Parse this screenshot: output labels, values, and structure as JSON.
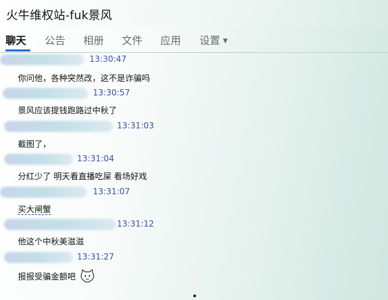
{
  "window": {
    "title": "火牛维权站-fuk景风"
  },
  "tabs": [
    {
      "label": "聊天"
    },
    {
      "label": "公告"
    },
    {
      "label": "相册"
    },
    {
      "label": "文件"
    },
    {
      "label": "应用"
    },
    {
      "label": "设置"
    }
  ],
  "messages": [
    {
      "time": "13:30:47",
      "text": "你问他，各种突然改，这不是诈骗吗"
    },
    {
      "time": "13:30:57",
      "text": "景风应该提钱跑路过中秋了"
    },
    {
      "time": "13:31:03",
      "text": "截图了，"
    },
    {
      "time": "13:31:04",
      "text": "分红少了 明天看直播吃屎 看场好戏"
    },
    {
      "time": "13:31:07",
      "text": "买大闸蟹"
    },
    {
      "time": "13:31:12",
      "text": "他这个中秋美滋滋"
    },
    {
      "time": "13:31:27",
      "text": "报报受骗金额吧"
    }
  ],
  "icons": {
    "settings_dropdown": "caret-down-icon",
    "emoji": "cat-face-emoji-icon"
  },
  "colors": {
    "accent": "#1f6fd1",
    "timestamp": "#3a4fb0"
  }
}
